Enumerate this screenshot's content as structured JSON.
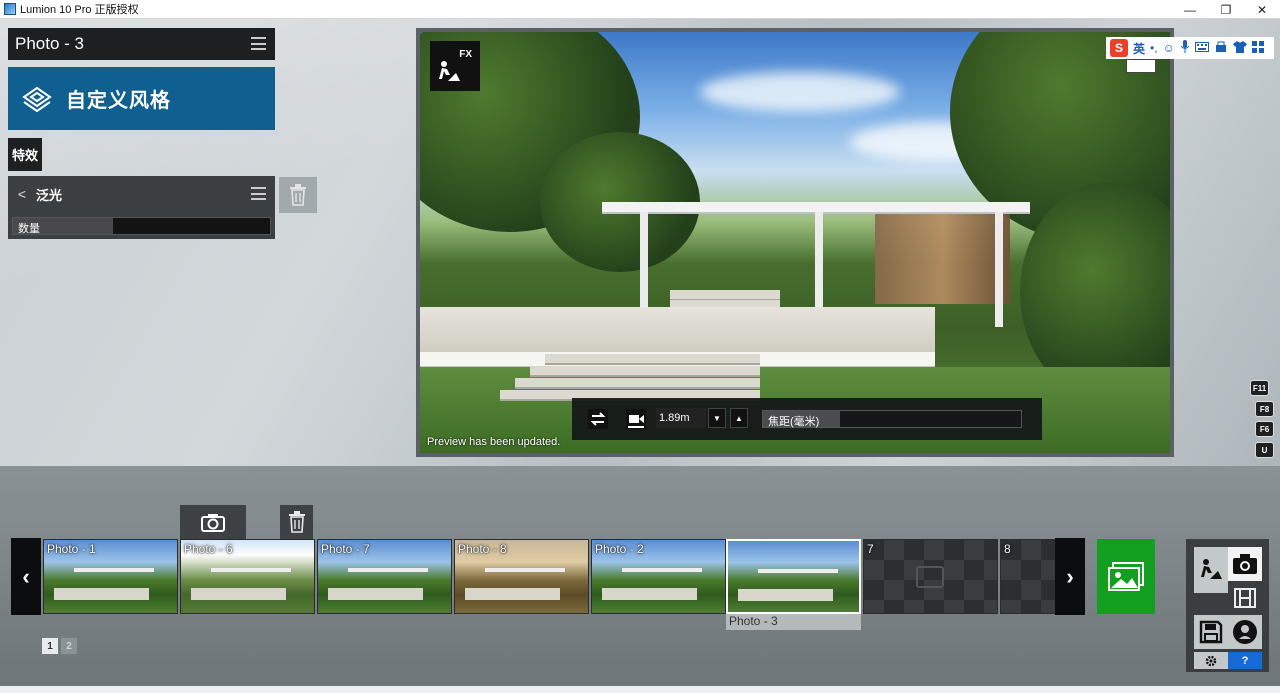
{
  "window": {
    "title": "Lumion 10 Pro 正版授权",
    "controls": [
      "—",
      "❐",
      "✕"
    ]
  },
  "left_panel": {
    "photo_title": "Photo - 3",
    "style_banner": "自定义风格",
    "effects_tab": "特效",
    "effect": {
      "name": "泛光",
      "slider_label": "数量",
      "slider_fraction": 0.39
    }
  },
  "preview": {
    "fx_label": "FX",
    "ime": {
      "logo": "S",
      "lang": "英",
      "symbols": [
        "•,",
        "☺",
        "🎤",
        "⌨",
        "☁",
        "👕",
        "▦"
      ]
    },
    "camera": {
      "focal_value": "1.89m",
      "focus_label": "焦距(毫米)",
      "focus_fraction": 0.3
    },
    "status": "Preview has been updated."
  },
  "fkeys": [
    "F11",
    "F8",
    "F6",
    "U"
  ],
  "strip": {
    "thumbnails": [
      {
        "label": "Photo - 1",
        "style": "normal"
      },
      {
        "label": "Photo - 6",
        "style": "sun"
      },
      {
        "label": "Photo - 7",
        "style": "normal"
      },
      {
        "label": "Photo - 8",
        "style": "warm"
      },
      {
        "label": "Photo - 2",
        "style": "normal"
      },
      {
        "label": "",
        "style": "selected"
      },
      {
        "label": "7",
        "style": "empty"
      },
      {
        "label": "8",
        "style": "empty"
      }
    ],
    "selected_label": "Photo - 3",
    "pages": [
      "1",
      "2"
    ]
  },
  "mode_panel": {
    "help": "?"
  }
}
